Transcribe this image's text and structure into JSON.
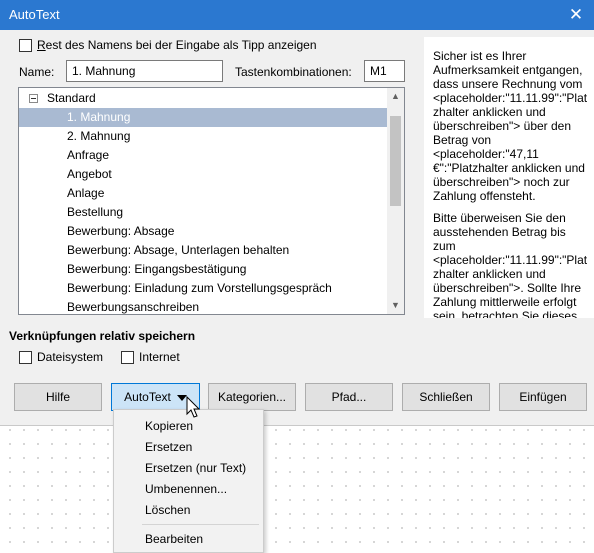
{
  "window": {
    "title": "AutoText",
    "close_glyph": "✕"
  },
  "tip_checkbox": {
    "label_first": "R",
    "label_rest": "est des Namens bei der Eingabe als Tipp anzeigen",
    "checked": false
  },
  "name_field": {
    "label": "Name:",
    "value": "1. Mahnung"
  },
  "shortcut_field": {
    "label": "Tastenkombinationen:",
    "value": "M1"
  },
  "tree": {
    "root": "Standard",
    "items": [
      "1. Mahnung",
      "2. Mahnung",
      "Anfrage",
      "Angebot",
      "Anlage",
      "Bestellung",
      "Bewerbung: Absage",
      "Bewerbung: Absage, Unterlagen behalten",
      "Bewerbung: Eingangsbestätigung",
      "Bewerbung: Einladung zum Vorstellungsgespräch",
      "Bewerbungsanschreiben"
    ],
    "selected_index": 0
  },
  "preview": {
    "para1": "Sicher ist es Ihrer Aufmerksamkeit entgangen, dass unsere Rechnung vom <placeholder:\"11.11.99\":\"Platzhalter anklicken und überschreiben\"> über den Betrag von <placeholder:\"47,11 €\":\"Platzhalter anklicken und überschreiben\"> noch zur Zahlung offensteht.",
    "para2": "Bitte überweisen Sie den ausstehenden Betrag bis zum <placeholder:\"11.11.99\":\"Platzhalter anklicken und überschreiben\">. Sollte Ihre Zahlung mittlerweile erfolgt sein, betrachten Sie dieses"
  },
  "links": {
    "title": "Verknüpfungen relativ speichern",
    "filesystem": {
      "label": "Dateisystem",
      "checked": false
    },
    "internet": {
      "label": "Internet",
      "checked": false
    }
  },
  "buttons": {
    "help": "Hilfe",
    "autotext": "AutoText",
    "categories": "Kategorien...",
    "path": "Pfad...",
    "close": "Schließen",
    "insert": "Einfügen"
  },
  "menu": {
    "items": [
      "Kopieren",
      "Ersetzen",
      "Ersetzen (nur Text)",
      "Umbenennen...",
      "Löschen",
      "Bearbeiten"
    ]
  },
  "colors": {
    "titlebar": "#2b78d0",
    "selection": "#a9bad2",
    "active_button": "#cce4f7"
  }
}
